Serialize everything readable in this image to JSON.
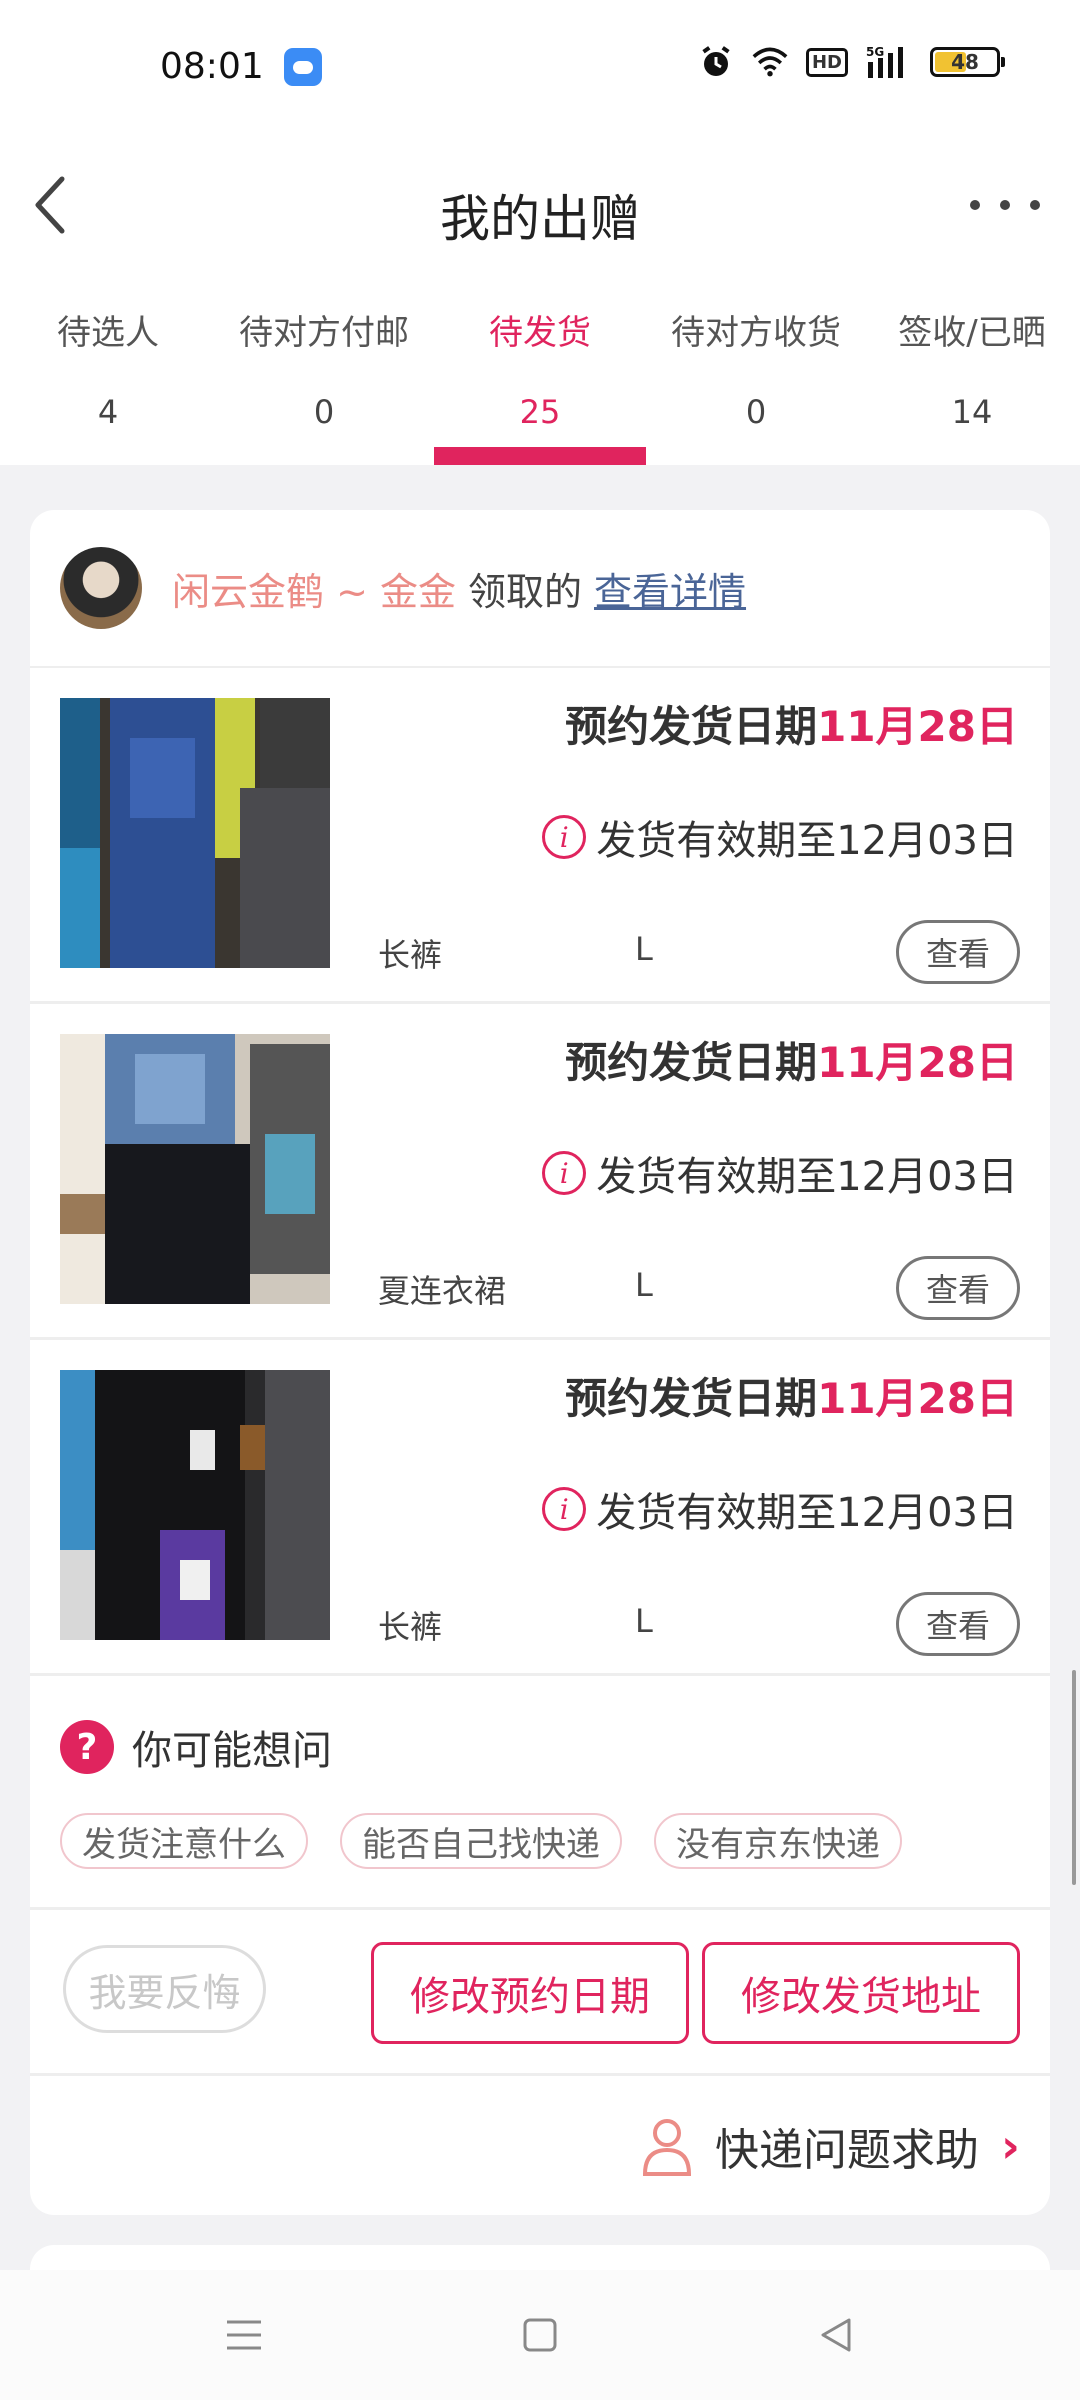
{
  "status": {
    "time": "08:01",
    "battery": "48",
    "network": "5G",
    "hd": "HD"
  },
  "header": {
    "title": "我的出赠"
  },
  "tabs": [
    {
      "label": "待选人",
      "count": "4"
    },
    {
      "label": "待对方付邮",
      "count": "0"
    },
    {
      "label": "待发货",
      "count": "25"
    },
    {
      "label": "待对方收货",
      "count": "0"
    },
    {
      "label": "签收/已晒",
      "count": "14"
    }
  ],
  "claim": {
    "name": "闲云金鹤 ~ 金金",
    "verb": "领取的",
    "link": "查看详情"
  },
  "items": [
    {
      "date_prefix": "预约发货日期",
      "date": "11月28日",
      "valid": "发货有效期至12月03日",
      "category": "长裤",
      "size": "L",
      "view": "查看"
    },
    {
      "date_prefix": "预约发货日期",
      "date": "11月28日",
      "valid": "发货有效期至12月03日",
      "category": "夏连衣裙",
      "size": "L",
      "view": "查看"
    },
    {
      "date_prefix": "预约发货日期",
      "date": "11月28日",
      "valid": "发货有效期至12月03日",
      "category": "长裤",
      "size": "L",
      "view": "查看"
    }
  ],
  "faq": {
    "title": "你可能想问",
    "chips": [
      "发货注意什么",
      "能否自己找快递",
      "没有京东快递"
    ]
  },
  "actions": {
    "regret": "我要反悔",
    "change_date": "修改预约日期",
    "change_address": "修改发货地址"
  },
  "help": {
    "label": "快递问题求助"
  },
  "colors": {
    "accent": "#e0245e",
    "name_pink": "#eb8c86",
    "link": "#4a6597"
  }
}
